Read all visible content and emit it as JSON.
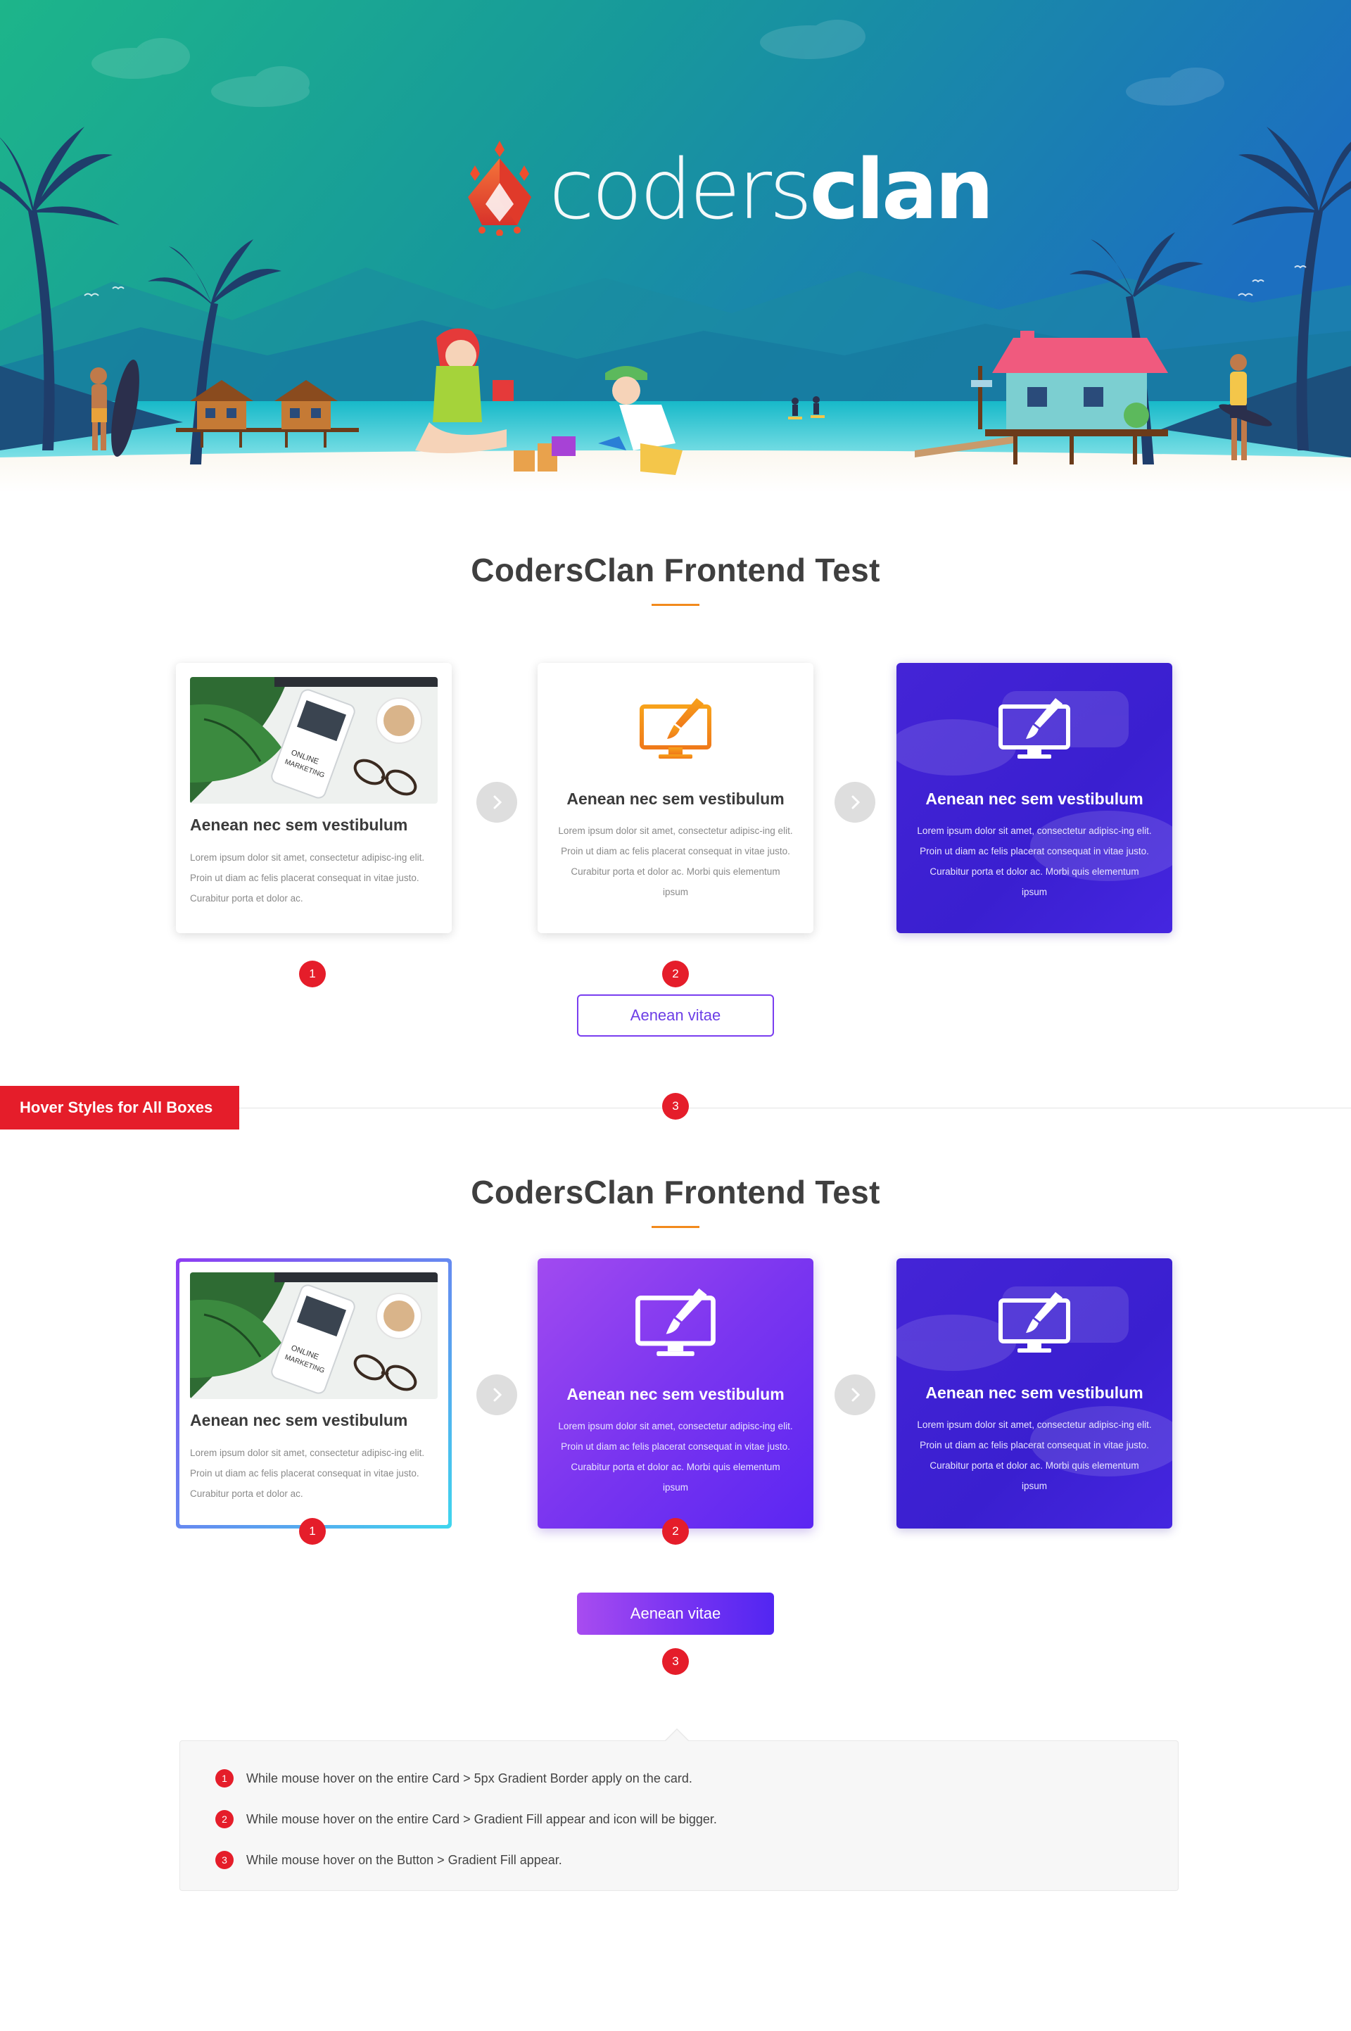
{
  "brand": {
    "logo_thin": "coders",
    "logo_bold": "clan"
  },
  "colors": {
    "accent_orange": "#f28a1d",
    "badge_red": "#e51d2a",
    "purple": "#4424d6",
    "gradient_start": "#a14af0",
    "gradient_end": "#5b26f2",
    "border_cyan": "#3fd6ee"
  },
  "section1": {
    "title": "CodersClan Frontend Test",
    "cards": [
      {
        "title": "Aenean nec sem vestibulum",
        "body": "Lorem ipsum dolor sit amet, consectetur adipisc-ing elit. Proin ut diam ac felis placerat consequat in vitae justo. Curabitur porta et dolor ac.",
        "icon": "photo-desk"
      },
      {
        "title": "Aenean nec sem vestibulum",
        "body": "Lorem ipsum dolor sit amet, consectetur adipisc-ing elit. Proin ut diam ac felis placerat consequat in vitae justo. Curabitur porta et dolor ac. Morbi quis elementum ipsum",
        "icon": "monitor-brush-icon"
      },
      {
        "title": "Aenean nec sem vestibulum",
        "body": "Lorem ipsum dolor sit amet, consectetur adipisc-ing elit. Proin ut diam ac felis placerat consequat in vitae justo. Curabitur porta et dolor ac. Morbi quis elementum ipsum",
        "icon": "monitor-brush-icon"
      }
    ],
    "button_label": "Aenean vitae",
    "badges": [
      "1",
      "2",
      "3"
    ]
  },
  "hover_label": "Hover Styles for All Boxes",
  "section2": {
    "title": "CodersClan Frontend Test",
    "cards": [
      {
        "title": "Aenean nec sem vestibulum",
        "body": "Lorem ipsum dolor sit amet, consectetur adipisc-ing elit. Proin ut diam ac felis placerat consequat in vitae justo. Curabitur porta et dolor ac."
      },
      {
        "title": "Aenean nec sem vestibulum",
        "body": "Lorem ipsum dolor sit amet, consectetur adipisc-ing elit. Proin ut diam ac felis placerat consequat in vitae justo. Curabitur porta et dolor ac. Morbi quis elementum ipsum"
      },
      {
        "title": "Aenean nec sem vestibulum",
        "body": "Lorem ipsum dolor sit amet, consectetur adipisc-ing elit. Proin ut diam ac felis placerat consequat in vitae justo. Curabitur porta et dolor ac. Morbi quis elementum ipsum"
      }
    ],
    "button_label": "Aenean vitae",
    "badges": [
      "1",
      "2",
      "3"
    ]
  },
  "notes": [
    {
      "num": "1",
      "text": "While mouse hover on the entire Card > 5px Gradient Border apply on the card."
    },
    {
      "num": "2",
      "text": "While mouse hover on the entire Card  > Gradient Fill appear and icon will be bigger."
    },
    {
      "num": "3",
      "text": "While mouse hover on the Button  > Gradient Fill appear."
    }
  ]
}
